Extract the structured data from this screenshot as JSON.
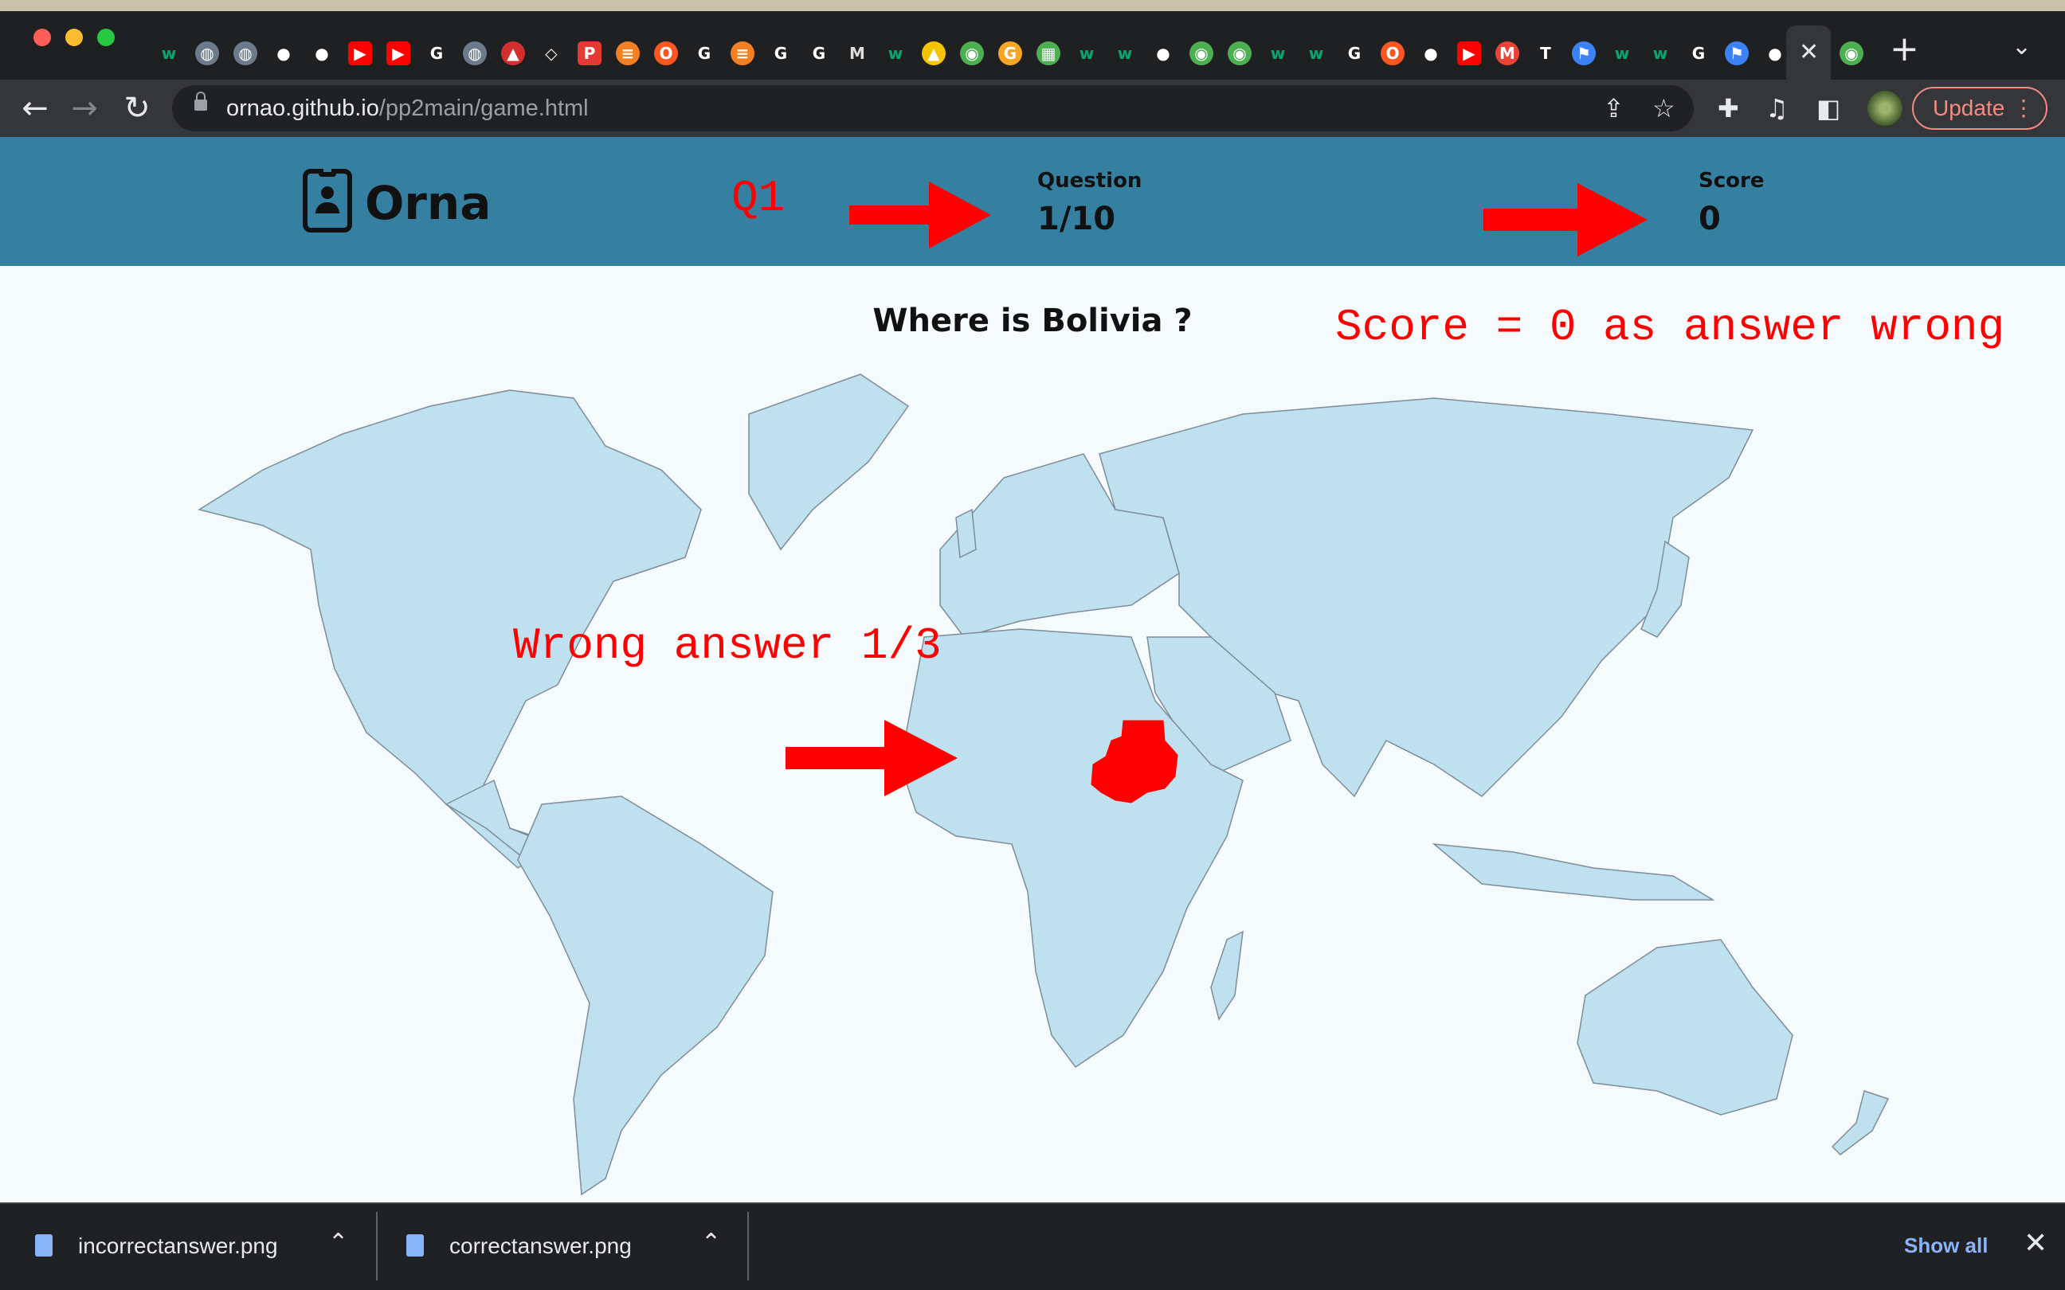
{
  "browser": {
    "url_host": "ornao.github.io",
    "url_path": "/pp2main/game.html",
    "update_label": "Update",
    "new_tab": "+",
    "tab_close": "✕",
    "tabs": [
      "w3",
      "globe",
      "globe",
      "github",
      "github",
      "youtube",
      "youtube",
      "google",
      "globe",
      "pencil",
      "codepen",
      "P",
      "stackoverflow",
      "o",
      "google",
      "stackoverflow",
      "google",
      "google",
      "M",
      "w3",
      "linux",
      "chrome",
      "G",
      "map",
      "w3",
      "w3",
      "medium",
      "chrome",
      "chrome",
      "w3",
      "w3",
      "google",
      "o",
      "medium",
      "youtube",
      "gmail",
      "T",
      "flag",
      "w3",
      "w3",
      "google",
      "flag",
      "github",
      "active",
      "chrome"
    ],
    "colors": {
      "tab_bar": "#1f2022",
      "toolbar": "#35363a",
      "accent": "#8ab4f8"
    }
  },
  "game": {
    "brand": "Orna",
    "question_label": "Question",
    "question_value": "1/10",
    "score_label": "Score",
    "score_value": "0",
    "prompt": "Where is Bolivia ?",
    "header_color": "#3580a1",
    "highlight_color": "#ff0000",
    "map_land_color": "#bfe0ee"
  },
  "annotations": {
    "q1": "Q1",
    "score_note": "Score = 0 as answer wrong",
    "wrong_note": "Wrong answer 1/3"
  },
  "downloads": {
    "items": [
      {
        "name": "incorrectanswer.png"
      },
      {
        "name": "correctanswer.png"
      }
    ],
    "show_all": "Show all"
  }
}
